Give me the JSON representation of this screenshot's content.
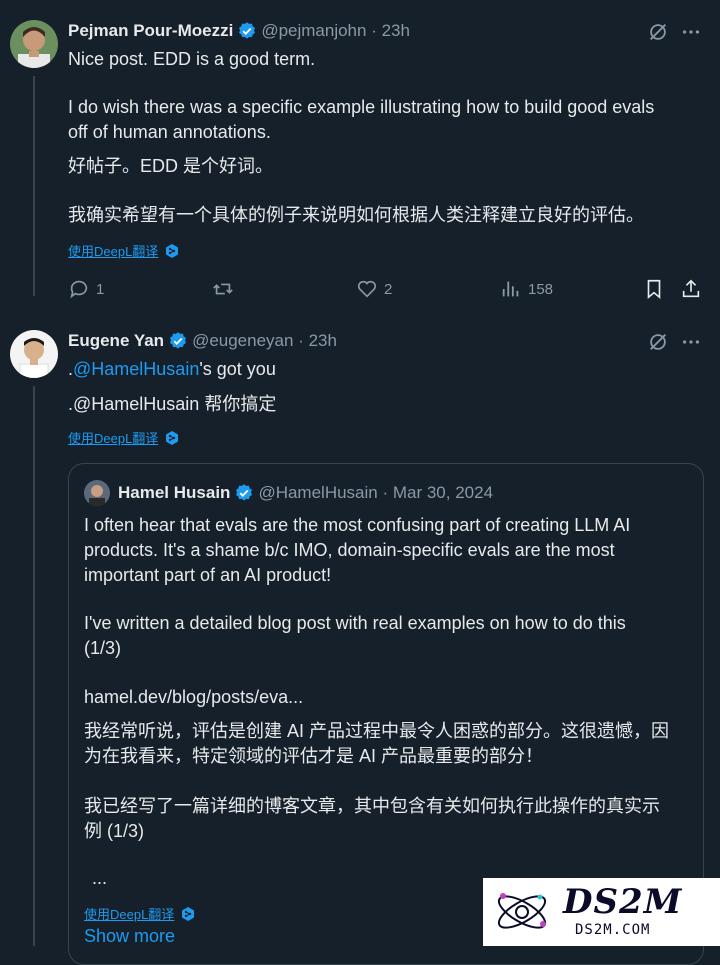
{
  "tweet1": {
    "author_name": "Pejman Pour-Moezzi",
    "handle_time": "@pejmanjohn · 23h",
    "text_line1": "Nice post. EDD is a good term.",
    "text_line2": "I do wish there was a specific example illustrating how to build good evals",
    "text_line3": "off of human annotations.",
    "translation_line1": "好帖子。EDD 是个好词。",
    "translation_line2": "我确实希望有一个具体的例子来说明如何根据人类注释建立良好的评估。",
    "translate_label": "使用DeepL翻译",
    "reply_count": "1",
    "retweet_count": "",
    "like_count": "2",
    "view_count": "158"
  },
  "tweet2": {
    "author_name": "Eugene Yan",
    "handle_time": "@eugeneyan · 23h",
    "text_prefix": ".",
    "mention": "@HamelHusain",
    "text_suffix": "'s got you",
    "translation": ".@HamelHusain 帮你搞定",
    "translate_label": "使用DeepL翻译"
  },
  "quote": {
    "author_name": "Hamel Husain",
    "handle_time": "@HamelHusain · Mar 30, 2024",
    "p1_line1": "I often hear that evals are the most confusing part of creating LLM AI",
    "p1_line2": "products.  It's a shame b/c IMO, domain-specific evals are the most",
    "p1_line3": "important part of an AI product!",
    "p2_line1": "I've written a detailed blog post with real examples on how to do this",
    "p2_line2": "(1/3)",
    "link": "hamel.dev/blog/posts/eva...",
    "zh_line1": "我经常听说，评估是创建 AI 产品过程中最令人困惑的部分。这很遗憾，因",
    "zh_line2": "为在我看来，特定领域的评估才是 AI 产品最重要的部分！",
    "zh_line3": "我已经写了一篇详细的博客文章，其中包含有关如何执行此操作的真实示",
    "zh_line4": "例 (1/3)",
    "ellipsis": "...",
    "translate_label": "使用DeepL翻译",
    "show_more": "Show more"
  },
  "watermark": {
    "title": "DS2M",
    "subtitle": "DS2M.COM"
  },
  "colors": {
    "background": "#15202b",
    "text": "#e7e9ea",
    "muted": "#8b98a5",
    "link": "#1d9bf0",
    "verified": "#1d9bf0"
  },
  "icons": {
    "grok": "slash-circle-icon",
    "more": "more-horizontal-icon",
    "reply": "reply-icon",
    "retweet": "retweet-icon",
    "like": "heart-icon",
    "views": "bar-chart-icon",
    "bookmark": "bookmark-icon",
    "share": "share-icon"
  }
}
